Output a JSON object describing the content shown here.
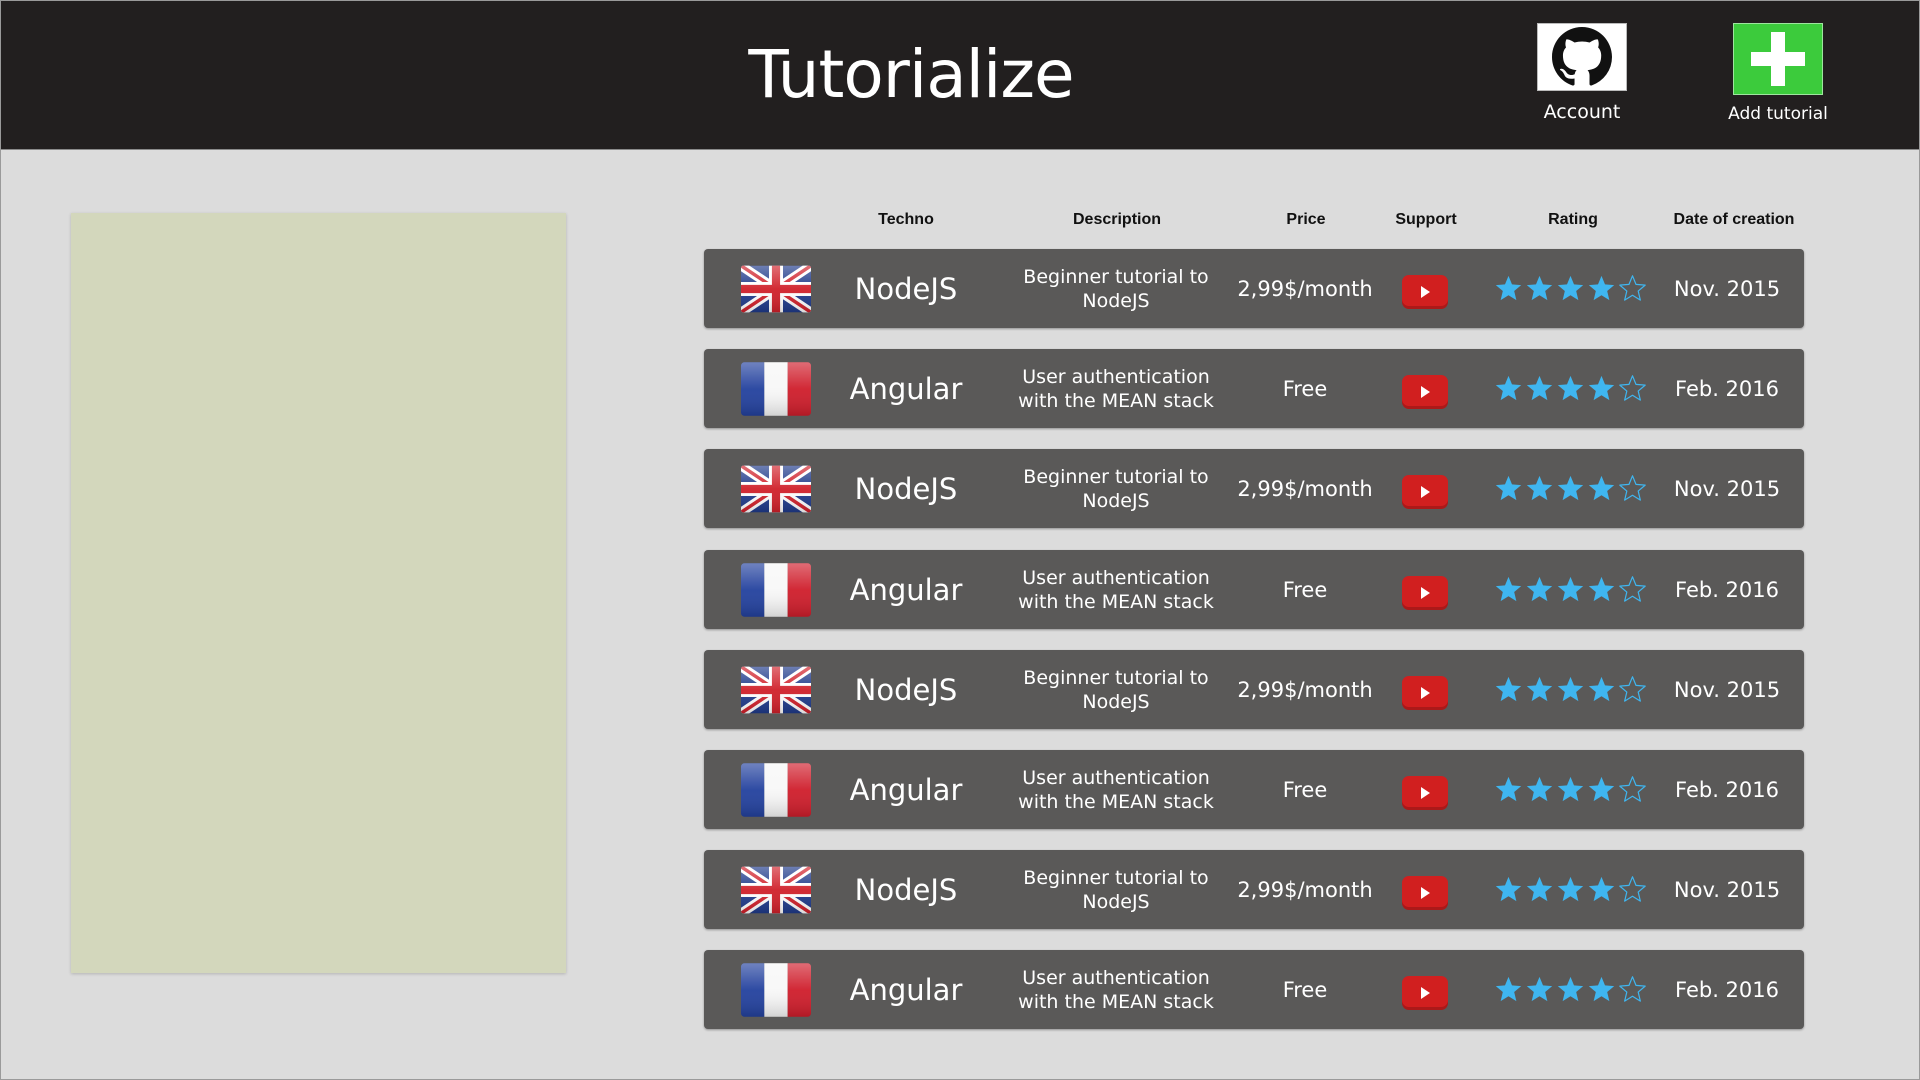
{
  "app": {
    "title": "Tutorialize"
  },
  "header": {
    "account_label": "Account",
    "account_icon": "github-icon",
    "add_label": "Add tutorial",
    "add_icon": "plus-icon"
  },
  "table": {
    "columns": {
      "techno": "Techno",
      "description": "Description",
      "price": "Price",
      "support": "Support",
      "rating": "Rating",
      "date": "Date of creation"
    },
    "rows": [
      {
        "flag": "uk-flag-icon",
        "techno": "NodeJS",
        "description": "Beginner tutorial to NodeJS",
        "price": "2,99$/month",
        "support": "youtube-icon",
        "rating": 4,
        "rating_max": 5,
        "date": "Nov. 2015"
      },
      {
        "flag": "france-flag-icon",
        "techno": "Angular",
        "description": "User authentication with the MEAN stack",
        "price": "Free",
        "support": "youtube-icon",
        "rating": 4,
        "rating_max": 5,
        "date": "Feb. 2016"
      },
      {
        "flag": "uk-flag-icon",
        "techno": "NodeJS",
        "description": "Beginner tutorial to NodeJS",
        "price": "2,99$/month",
        "support": "youtube-icon",
        "rating": 4,
        "rating_max": 5,
        "date": "Nov. 2015"
      },
      {
        "flag": "france-flag-icon",
        "techno": "Angular",
        "description": "User authentication with the MEAN stack",
        "price": "Free",
        "support": "youtube-icon",
        "rating": 4,
        "rating_max": 5,
        "date": "Feb. 2016"
      },
      {
        "flag": "uk-flag-icon",
        "techno": "NodeJS",
        "description": "Beginner tutorial to NodeJS",
        "price": "2,99$/month",
        "support": "youtube-icon",
        "rating": 4,
        "rating_max": 5,
        "date": "Nov. 2015"
      },
      {
        "flag": "france-flag-icon",
        "techno": "Angular",
        "description": "User authentication with the MEAN stack",
        "price": "Free",
        "support": "youtube-icon",
        "rating": 4,
        "rating_max": 5,
        "date": "Feb. 2016"
      },
      {
        "flag": "uk-flag-icon",
        "techno": "NodeJS",
        "description": "Beginner tutorial to NodeJS",
        "price": "2,99$/month",
        "support": "youtube-icon",
        "rating": 4,
        "rating_max": 5,
        "date": "Nov. 2015"
      },
      {
        "flag": "france-flag-icon",
        "techno": "Angular",
        "description": "User authentication with the MEAN stack",
        "price": "Free",
        "support": "youtube-icon",
        "rating": 4,
        "rating_max": 5,
        "date": "Feb. 2016"
      }
    ]
  },
  "colors": {
    "header_bg": "#221f1f",
    "page_bg": "#dcdcdc",
    "panel_bg": "#d3d7bc",
    "row_bg": "#5a5958",
    "star": "#3fb6f0",
    "youtube": "#d11f1f",
    "add_button": "#3ccb3c"
  }
}
